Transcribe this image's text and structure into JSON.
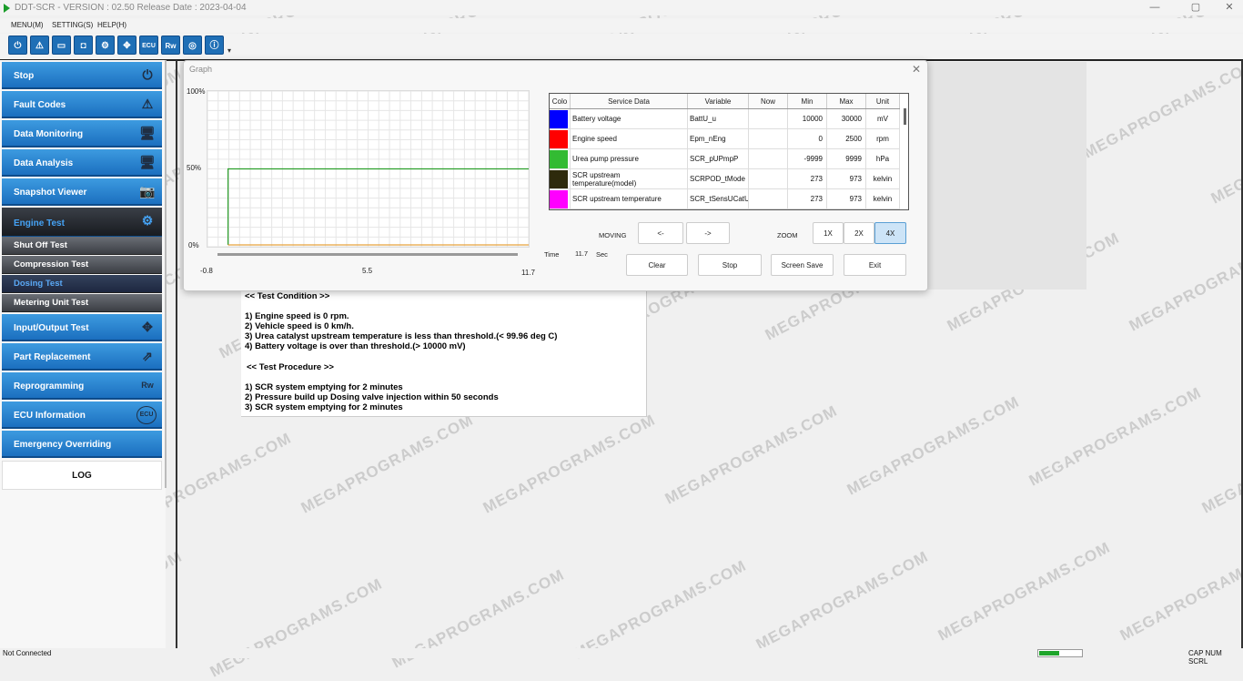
{
  "title_bar": {
    "title": "DDT-SCR - VERSION : 02.50 Release Date : 2023-04-04",
    "minimize": "—",
    "maximize": "▢",
    "close": "✕"
  },
  "menu": [
    "MENU(M)",
    "SETTING(S)",
    "HELP(H)"
  ],
  "toolbar": {
    "icons": [
      "power-icon",
      "warning-icon",
      "monitor-icon",
      "camera-icon",
      "engine-icon",
      "move-icon",
      "ecu-icon",
      "reprogram-icon",
      "ecu-info-icon",
      "info-icon"
    ],
    "ecu_text": "ECU",
    "rw_text": "Rw"
  },
  "sidebar": {
    "items": [
      {
        "label": "Stop",
        "icon": "⏻"
      },
      {
        "label": "Fault Codes",
        "icon": "⚠"
      },
      {
        "label": "Data Monitoring",
        "icon": "🖥"
      },
      {
        "label": "Data Analysis",
        "icon": "🖥"
      },
      {
        "label": "Snapshot Viewer",
        "icon": "📷"
      },
      {
        "label": "Engine Test",
        "icon": "⚙"
      }
    ],
    "subitems": [
      "Shut Off Test",
      "Compression Test",
      "Dosing Test",
      "Metering Unit Test"
    ],
    "items2": [
      {
        "label": "Input/Output Test",
        "icon": "✥"
      },
      {
        "label": "Part Replacement",
        "icon": "⇗"
      },
      {
        "label": "Reprogramming",
        "icon": "Rw"
      },
      {
        "label": "ECU Information",
        "icon": "ECU"
      },
      {
        "label": "Emergency Overriding",
        "icon": ""
      }
    ],
    "log": "LOG"
  },
  "test_content": {
    "condition_header": "<< Test Condition >>",
    "conditions": [
      "1) Engine speed is 0 rpm.",
      "2) Vehicle speed is 0 km/h.",
      "3) Urea catalyst upstream temperature is less than threshold.(< 99.96 deg C)",
      "4) Battery voltage is over than threshold.(> 10000 mV)"
    ],
    "procedure_header": "<< Test Procedure >>",
    "procedures": [
      "1) SCR system emptying for 2 minutes",
      "2) Pressure build up  Dosing valve injection within 50 seconds",
      "3) SCR system emptying for 2 minutes"
    ]
  },
  "graph_dialog": {
    "title": "Graph",
    "close": "✕",
    "y_labels": [
      "100%",
      "50%",
      "0%"
    ],
    "x_labels": [
      "-0.8",
      "5.5",
      "11.7"
    ],
    "time_label": "Time",
    "time_value": "11.7",
    "time_unit": "Sec",
    "series": [
      {
        "color": "#2ca02c",
        "points": [
          [
            0.0,
            0
          ],
          [
            0.0,
            50
          ],
          [
            11.7,
            50
          ]
        ]
      },
      {
        "color": "#e8a23c",
        "points": [
          [
            0.0,
            0
          ],
          [
            11.7,
            0
          ]
        ]
      }
    ],
    "table": {
      "headers": [
        "Colo",
        "Service Data",
        "Variable",
        "Now",
        "Min",
        "Max",
        "Unit"
      ],
      "rows": [
        {
          "color": "#0000ff",
          "service": "Battery voltage",
          "variable": "BattU_u",
          "now": "",
          "min": "10000",
          "max": "30000",
          "unit": "mV"
        },
        {
          "color": "#ff0000",
          "service": "Engine speed",
          "variable": "Epm_nEng",
          "now": "",
          "min": "0",
          "max": "2500",
          "unit": "rpm"
        },
        {
          "color": "#33bb33",
          "service": "Urea pump pressure",
          "variable": "SCR_pUPmpP",
          "now": "",
          "min": "-9999",
          "max": "9999",
          "unit": "hPa"
        },
        {
          "color": "#2e2a0c",
          "service": "SCR upstream temperature(model)",
          "variable": "SCRPOD_tMode",
          "now": "",
          "min": "273",
          "max": "973",
          "unit": "kelvin"
        },
        {
          "color": "#ff00ff",
          "service": "SCR upstream temperature",
          "variable": "SCR_tSensUCatU",
          "now": "",
          "min": "273",
          "max": "973",
          "unit": "kelvin"
        }
      ]
    },
    "moving_label": "MOVING",
    "move_left": "<-",
    "move_right": "->",
    "zoom_label": "ZOOM",
    "zoom_options": [
      "1X",
      "2X",
      "4X"
    ],
    "zoom_selected": "4X",
    "buttons": {
      "clear": "Clear",
      "stop": "Stop",
      "screen_save": "Screen Save",
      "exit": "Exit"
    }
  },
  "status_bar": {
    "connection": "Not Connected",
    "progress_fraction": 0.45,
    "indicators": "CAP  NUM  SCRL"
  },
  "watermark": "MEGAPROGRAMS.COM"
}
